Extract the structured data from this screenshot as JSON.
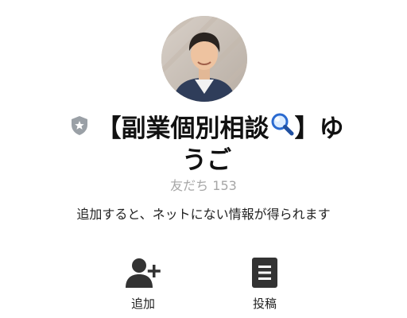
{
  "profile": {
    "avatar_icon": "profile-photo",
    "badge_icon": "shield-star-icon",
    "name_line1_prefix": "【副業個別相談",
    "name_emoji": "magnifying-glass-icon",
    "name_line1_suffix": "】ゆ",
    "name_line2": "うご",
    "friends_label": "友だち 153",
    "description": "追加すると、ネットにない情報が得られます"
  },
  "actions": [
    {
      "label": "追加",
      "icon": "add-friend-icon"
    },
    {
      "label": "投稿",
      "icon": "post-icon"
    }
  ],
  "colors": {
    "text": "#111111",
    "muted": "#a6a6a6",
    "icon": "#333333",
    "badge": "#9aa0a6",
    "emoji": "#2a6ad0"
  }
}
